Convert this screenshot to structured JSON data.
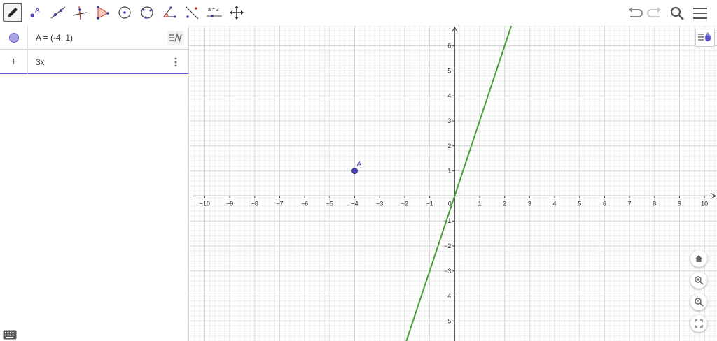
{
  "toolbar": {
    "tools": [
      {
        "name": "move-tool",
        "icon": "pencil-icon",
        "active": true
      },
      {
        "name": "point-tool",
        "icon": "point-icon"
      },
      {
        "name": "line-tool",
        "icon": "line-icon"
      },
      {
        "name": "perpendicular-tool",
        "icon": "perpendicular-icon"
      },
      {
        "name": "polygon-tool",
        "icon": "polygon-icon"
      },
      {
        "name": "circle-tool",
        "icon": "circle-center-icon"
      },
      {
        "name": "circle-3pts-tool",
        "icon": "circle-three-points-icon"
      },
      {
        "name": "angle-tool",
        "icon": "angle-icon"
      },
      {
        "name": "reflect-tool",
        "icon": "reflect-icon"
      },
      {
        "name": "slider-tool",
        "icon": "slider-icon",
        "label": "a = 2"
      },
      {
        "name": "move-view-tool",
        "icon": "move-arrows-icon"
      }
    ],
    "right": [
      "undo-icon",
      "redo-icon",
      "search-icon",
      "menu-icon"
    ]
  },
  "algebra": {
    "rows": [
      {
        "text": "A = (-4, 1)",
        "marble": "#a9a3e6"
      },
      {
        "text": "3x",
        "prefix": "+"
      }
    ]
  },
  "graphics": {
    "point": {
      "label": "A",
      "x": -4,
      "y": 1,
      "color": "#4a3fb5"
    },
    "line": {
      "expression": "3x",
      "slope": 3,
      "intercept": 0,
      "color": "#4f9a3f"
    },
    "x_range": [
      -10.6,
      10.5
    ],
    "y_range": [
      -5.8,
      6.8
    ],
    "x_ticks": [
      -10,
      -9,
      -8,
      -7,
      -6,
      -5,
      -4,
      -3,
      -2,
      -1,
      0,
      1,
      2,
      3,
      4,
      5,
      6,
      7,
      8,
      9,
      10
    ],
    "y_ticks": [
      -5,
      -4,
      -3,
      -2,
      -1,
      1,
      2,
      3,
      4,
      5,
      6
    ],
    "grid": true
  }
}
